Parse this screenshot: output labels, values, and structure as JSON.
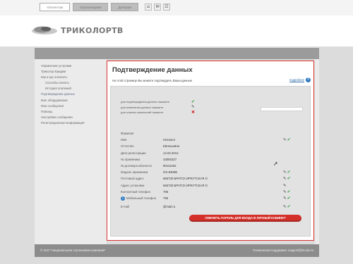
{
  "top_tabs": [
    "Абонентам",
    "Организациям",
    "Дилерам"
  ],
  "top_icons": [
    "home-icon",
    "mail-icon",
    "sitemap-icon"
  ],
  "logo": {
    "text": "ТРИКОЛОРТВ"
  },
  "sidebar": {
    "items": [
      "Управление услугами",
      "Триколор Бриджи",
      "Как и где оплатить",
      "Способы оплаты",
      "История платежей",
      "Подтверждение данных",
      "Мое оборудование",
      "Мои сообщения",
      "Помощь",
      "Настройки сообщения",
      "Регистрационная информация"
    ]
  },
  "main": {
    "title": "Подтверждение данных",
    "subtitle": "На этой странице Вы можете подтвердить Ваши данные",
    "help_link": "подробнее",
    "help_glyph": "?"
  },
  "legend": [
    {
      "label": "для подтверждения данных нажмите",
      "icon": "check-icon"
    },
    {
      "label": "для изменения данных нажмите",
      "icon": "pencil-icon"
    },
    {
      "label": "для отмены изменений нажмите",
      "icon": "cross-icon"
    }
  ],
  "fields": [
    {
      "label": "Фамилия",
      "value": "",
      "icons": []
    },
    {
      "label": "Имя",
      "value": "Наталья",
      "icons": [
        "pencil-icon",
        "check-icon"
      ]
    },
    {
      "label": "Отчество",
      "value": "Евгеньевна",
      "icons": []
    },
    {
      "label": "Дата регистрации",
      "value": "14.02.2013",
      "icons": []
    },
    {
      "label": "№ приемника",
      "value": "43093327",
      "icons": []
    },
    {
      "label": "№ договора абонента",
      "value": "90111452",
      "icons": []
    },
    {
      "label": "Модель приемника",
      "value": "GS-8306B",
      "icons": [
        "pencil-icon",
        "check-icon"
      ]
    },
    {
      "label": "Почтовый адрес",
      "value": "665730 БРАТСК ИРКУТСКАЯ О",
      "icons": [
        "pencil-icon",
        "check-icon"
      ]
    },
    {
      "label": "Адрес установки",
      "value": "665730 БРАТСК ИРКУТСКАЯ О",
      "icons": [
        "pencil-icon"
      ]
    },
    {
      "label": "Контактный телефон",
      "value": "795",
      "icons": [
        "pencil-icon",
        "check-icon"
      ]
    },
    {
      "label": "Мобильный телефон",
      "value": "795",
      "icons": [
        "pencil-icon",
        "check-icon"
      ],
      "info": "i"
    },
    {
      "label": "E-mail",
      "value": "@mail.ru",
      "icons": [
        "pencil-icon",
        "check-icon"
      ]
    }
  ],
  "change_password_button": "СМЕНИТЬ ПАРОЛЬ ДЛЯ ВХОДА В ЛИЧНЫЙ КАБИНЕТ",
  "footer": {
    "left": "© ЗАО \"Национальная спутниковая компания\"",
    "right": "Техническая поддержка: support@tricolor.tv"
  },
  "colors": {
    "accent": "#d4302a",
    "check": "#2e9d3a",
    "link": "#2e6aa8"
  }
}
